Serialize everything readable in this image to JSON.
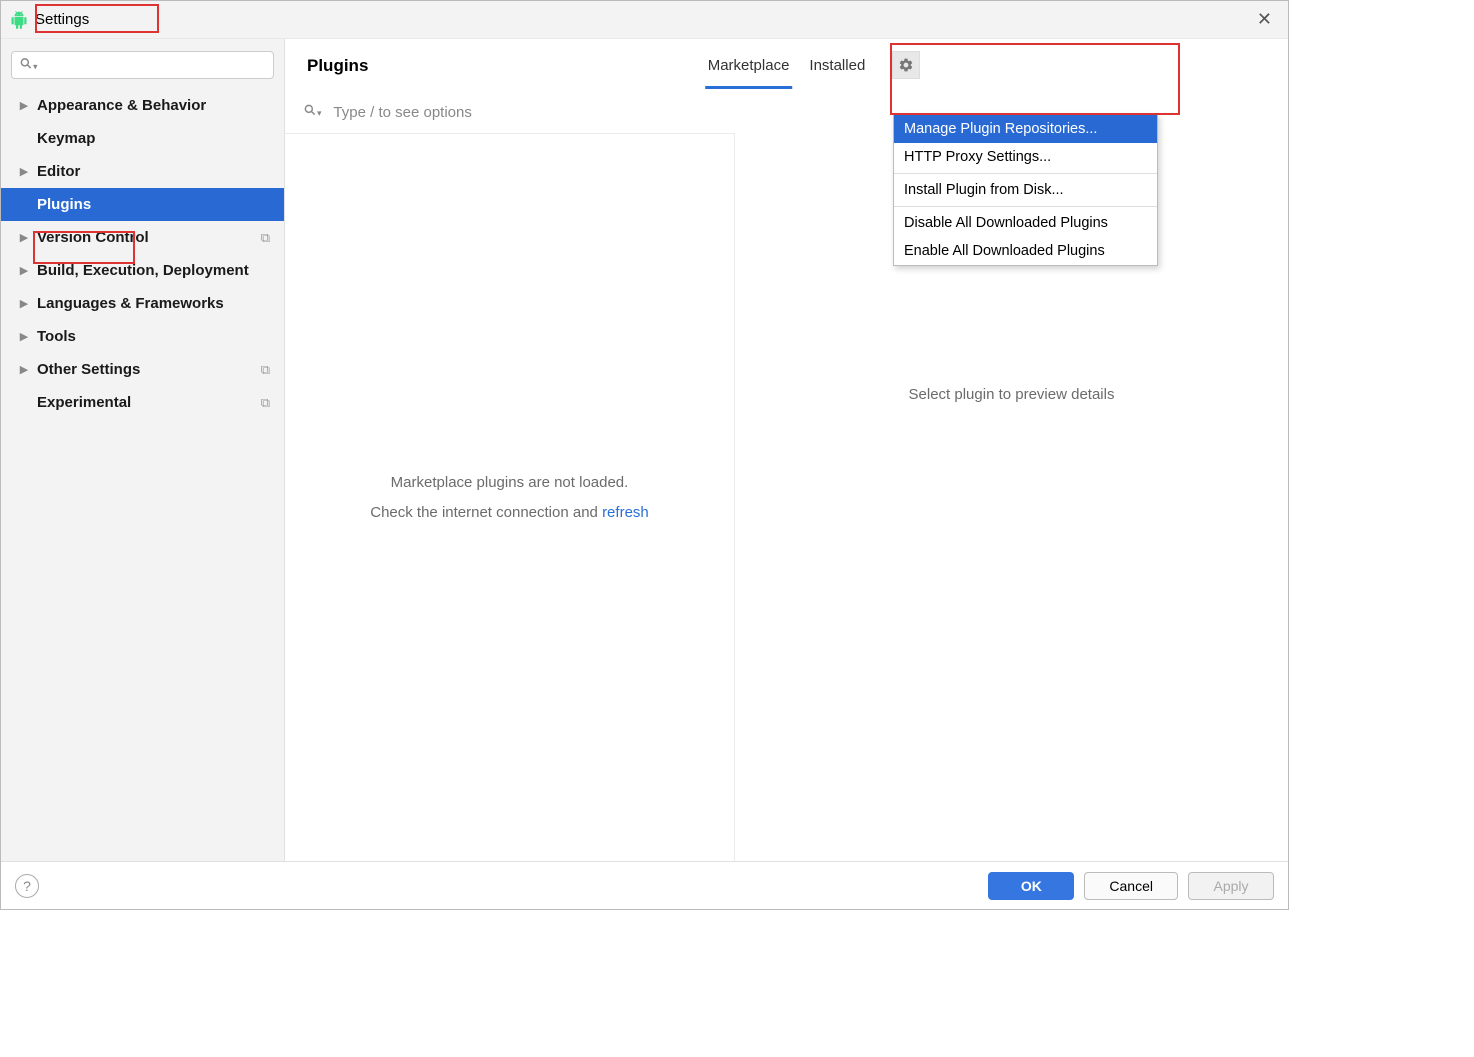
{
  "window": {
    "title": "Settings"
  },
  "sidebar": {
    "search_placeholder": "",
    "items": [
      {
        "label": "Appearance & Behavior",
        "expandable": true
      },
      {
        "label": "Keymap",
        "expandable": false
      },
      {
        "label": "Editor",
        "expandable": true
      },
      {
        "label": "Plugins",
        "expandable": false,
        "selected": true
      },
      {
        "label": "Version Control",
        "expandable": true,
        "scheme": true
      },
      {
        "label": "Build, Execution, Deployment",
        "expandable": true
      },
      {
        "label": "Languages & Frameworks",
        "expandable": true
      },
      {
        "label": "Tools",
        "expandable": true
      },
      {
        "label": "Other Settings",
        "expandable": true,
        "scheme": true
      },
      {
        "label": "Experimental",
        "expandable": false,
        "scheme": true
      }
    ]
  },
  "content": {
    "title": "Plugins",
    "tabs": {
      "marketplace": "Marketplace",
      "installed": "Installed"
    },
    "search_placeholder": "Type / to see options",
    "empty_line1": "Marketplace plugins are not loaded.",
    "empty_line2_prefix": "Check the internet connection and ",
    "empty_line2_link": "refresh",
    "right_placeholder": "Select plugin to preview details"
  },
  "menu": {
    "manage_repos": "Manage Plugin Repositories...",
    "http_proxy": "HTTP Proxy Settings...",
    "install_from_disk": "Install Plugin from Disk...",
    "disable_all": "Disable All Downloaded Plugins",
    "enable_all": "Enable All Downloaded Plugins"
  },
  "buttons": {
    "ok": "OK",
    "cancel": "Cancel",
    "apply": "Apply"
  }
}
